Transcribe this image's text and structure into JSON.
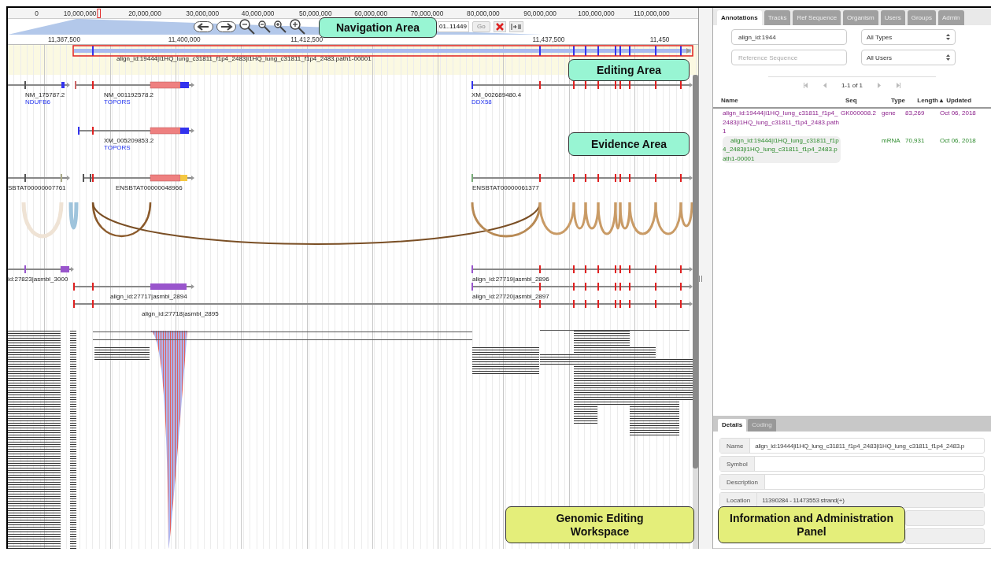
{
  "overview_ruler": {
    "ticks": [
      "0",
      "10,000,000",
      "20,000,000",
      "30,000,000",
      "40,000,000",
      "50,000,000",
      "60,000,000",
      "70,000,000",
      "80,000,000",
      "90,000,000",
      "100,000,000",
      "110,000,000"
    ]
  },
  "navigation": {
    "location": "01..11449",
    "go_button": "Go"
  },
  "detail_ruler": {
    "ticks": [
      "11,387,500",
      "11,400,000",
      "11,412,500",
      "11,437,500",
      "11,450"
    ]
  },
  "editing_area": {
    "feature": {
      "label": "align_id:19444|i1HQ_lung_c31811_f1p4_2483|i1HQ_lung_c31811_f1p4_2483.path1-00001",
      "selected": true
    }
  },
  "evidence_tracks": {
    "features": [
      {
        "label": "NM_175787.2",
        "gene": "NDUFB6"
      },
      {
        "label": "NM_001192578.2",
        "gene": "TOPORS"
      },
      {
        "label": "XM_002689480.4",
        "gene": "DDX58"
      },
      {
        "label": "XM_005209853.2",
        "gene": "TOPORS"
      },
      {
        "label": "SBTAT00000007761"
      },
      {
        "label": "ENSBTAT00000048966"
      },
      {
        "label": "ENSBTAT00000061377"
      },
      {
        "label": "id:27823|asmbl_3000"
      },
      {
        "label": "align_id:27719|asmbl_2896"
      },
      {
        "label": "align_id:27717|asmbl_2894"
      },
      {
        "label": "align_id:27720|asmbl_2897"
      },
      {
        "label": "align_id:27718|asmbl_2895"
      }
    ]
  },
  "panel": {
    "tabs": [
      {
        "label": "Annotations",
        "selected": true
      },
      {
        "label": "Tracks",
        "selected": false
      },
      {
        "label": "Ref Sequence",
        "selected": false
      },
      {
        "label": "Organism",
        "selected": false
      },
      {
        "label": "Users",
        "selected": false
      },
      {
        "label": "Groups",
        "selected": false
      },
      {
        "label": "Admin",
        "selected": false
      }
    ],
    "filters": {
      "name_value": "align_id:1944",
      "type": "All Types",
      "sequence_placeholder": "Reference Sequence",
      "user": "All Users"
    },
    "pager": "1-1 of 1",
    "columns": [
      "Name",
      "Seq",
      "Type",
      "Length",
      "▲ Updated"
    ],
    "rows": [
      {
        "kind": "gene",
        "name": "align_id:19444|i1HQ_lung_c31811_f1p4_2483|i1HQ_lung_c31811_f1p4_2483.path1",
        "seq": "GK000008.2",
        "type": "gene",
        "length": "83,269",
        "updated": "Oct 06, 2018"
      },
      {
        "kind": "mrna",
        "name": "align_id:19444|i1HQ_lung_c31811_f1p4_2483|i1HQ_lung_c31811_f1p4_2483.path1-00001",
        "type": "mRNA",
        "length": "70,931",
        "updated": "Oct 06, 2018"
      }
    ],
    "detail_tabs": [
      {
        "label": "Details",
        "selected": true
      },
      {
        "label": "Coding",
        "selected": false
      }
    ],
    "details": [
      {
        "label": "Name",
        "value": "align_id:19444|i1HQ_lung_c31811_f1p4_2483|i1HQ_lung_c31811_f1p4_2483.p",
        "readonly": false
      },
      {
        "label": "Symbol",
        "readonly": false
      },
      {
        "label": "Description",
        "readonly": false
      },
      {
        "label": "Location",
        "value": "11390284 - 11473553 strand(+)",
        "readonly": true
      },
      {
        "readonly": true
      },
      {
        "readonly": true
      }
    ]
  },
  "callouts": [
    {
      "text": "Navigation Area",
      "color": "#98f5d3"
    },
    {
      "text": "Editing Area",
      "color": "#98f5d3"
    },
    {
      "text": "Evidence Area",
      "color": "#98f5d3"
    },
    {
      "text": "Genomic Editing Workspace",
      "color": "#e4ee7a"
    },
    {
      "text": "Information and Administration Panel",
      "color": "#e4ee7a"
    }
  ]
}
